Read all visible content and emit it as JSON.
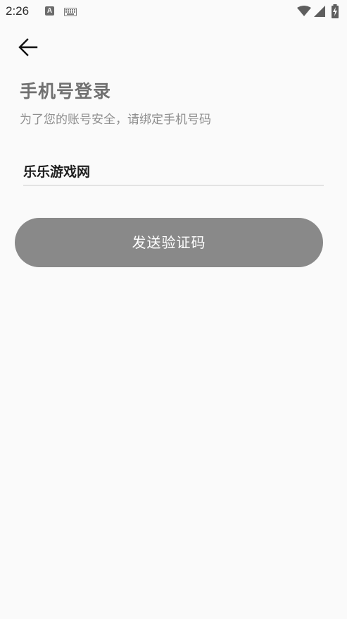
{
  "status_bar": {
    "time": "2:26",
    "a_icon_letter": "A",
    "icons": [
      "a-notification-icon",
      "keyboard-icon",
      "wifi-icon",
      "signal-icon",
      "battery-charging-icon"
    ]
  },
  "header": {
    "back_icon": "arrow-left-icon"
  },
  "login": {
    "title": "手机号登录",
    "subtitle": "为了您的账号安全，请绑定手机号码",
    "phone_value": "乐乐游戏网",
    "send_code_label": "发送验证码"
  },
  "colors": {
    "background": "#fafafa",
    "title": "#707070",
    "subtitle": "#8e8e8e",
    "button_bg": "#898989",
    "button_text": "#ffffff",
    "underline": "#e3e3e3"
  }
}
